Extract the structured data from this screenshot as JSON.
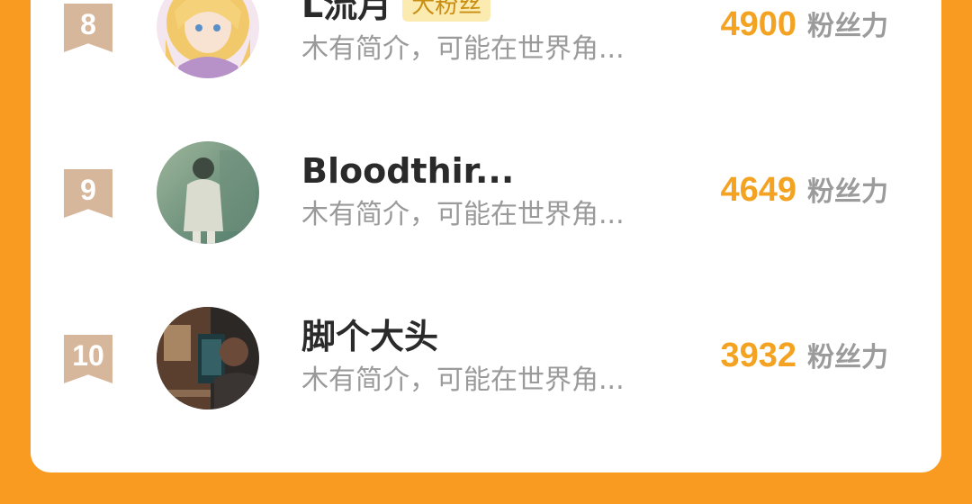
{
  "leaderboard": {
    "rows": [
      {
        "rank": "8",
        "name": "L流月",
        "tag": "大粉丝",
        "bio": "木有简介，可能在世界角...",
        "score": "4900",
        "unit": "粉丝力",
        "avatar_icon": "anime-girl-avatar"
      },
      {
        "rank": "9",
        "name": "Bloodthir...",
        "tag": "",
        "bio": "木有简介，可能在世界角...",
        "score": "4649",
        "unit": "粉丝力",
        "avatar_icon": "person-photo-avatar"
      },
      {
        "rank": "10",
        "name": "脚个大头",
        "tag": "",
        "bio": "木有简介，可能在世界角...",
        "score": "3932",
        "unit": "粉丝力",
        "avatar_icon": "person-photo-avatar"
      }
    ]
  },
  "colors": {
    "background": "#F99A21",
    "card": "#FFFFFF",
    "rank_badge": "#D7B79B",
    "score": "#F3A321",
    "unit": "#9B9B9B",
    "tag_bg": "#FCEBB0",
    "tag_text": "#C98E12"
  }
}
